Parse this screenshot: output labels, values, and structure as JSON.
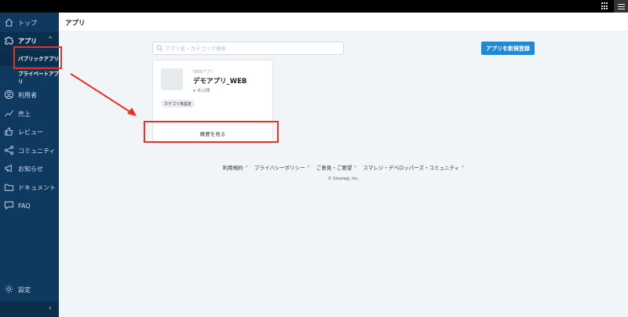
{
  "sidebar": {
    "items": [
      {
        "label": "トップ",
        "icon": "home-icon"
      },
      {
        "label": "アプリ",
        "icon": "puzzle-icon"
      },
      {
        "label": "利用者",
        "icon": "user-icon"
      },
      {
        "label": "売上",
        "icon": "line-chart-icon"
      },
      {
        "label": "レビュー",
        "icon": "thumbs-up-icon"
      },
      {
        "label": "コミュニティ",
        "icon": "share-icon"
      },
      {
        "label": "お知らせ",
        "icon": "megaphone-icon"
      },
      {
        "label": "ドキュメント",
        "icon": "folder-icon"
      },
      {
        "label": "FAQ",
        "icon": "chat-icon"
      }
    ],
    "app_submenu": [
      "パブリックアプリ",
      "プライベートアプリ"
    ],
    "settings_label": "設定",
    "collapse_icon": "chevron-left-icon"
  },
  "header": {
    "title": "アプリ"
  },
  "search": {
    "placeholder": "アプリ名・カテゴリで検索",
    "value": ""
  },
  "toolbar": {
    "add_label": "アプリを新規登録",
    "accent": "#1c8ad6"
  },
  "app_card": {
    "type": "WEBアプリ",
    "name": "デモアプリ_WEB",
    "status": "未公開",
    "category": "カテゴリ未設定",
    "detail_label": "概要を見る"
  },
  "footer": {
    "links": [
      "利用規約",
      "プライバシーポリシー",
      "ご意見・ご要望",
      "スマレジ・デベロッパーズ・コミュニティ"
    ],
    "copyright": "© Smaregi, Inc."
  },
  "annotation_color": "#e53222"
}
